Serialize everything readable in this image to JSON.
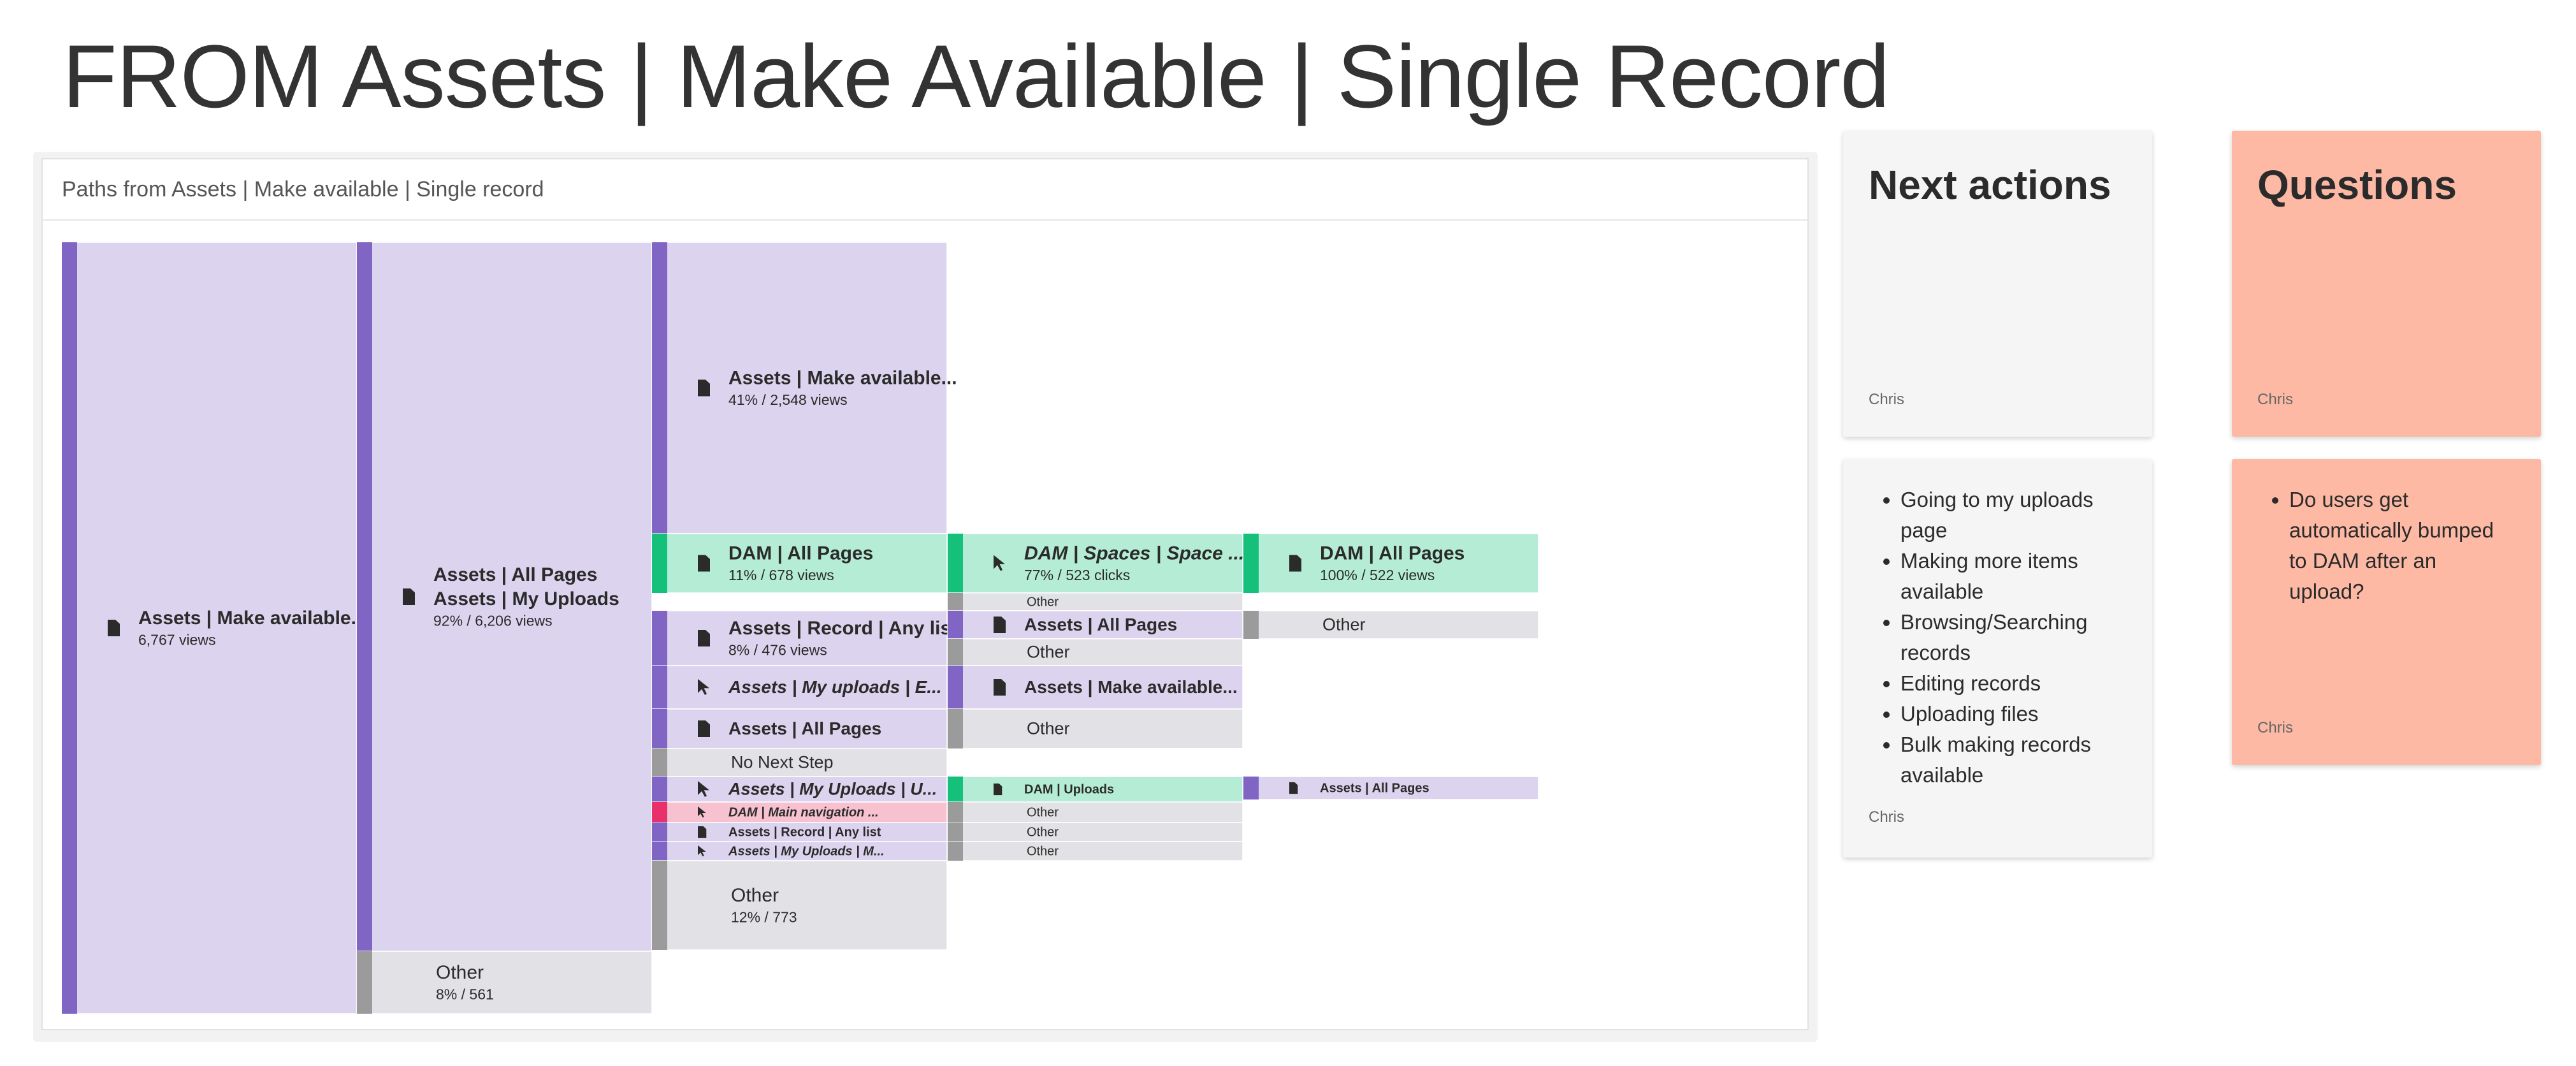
{
  "page": {
    "title": "FROM Assets | Make Available | Single Record"
  },
  "panel": {
    "title": "Paths from Assets | Make available | Single record"
  },
  "colors": {
    "purple_bar": "#8065c4",
    "purple_fill": "#dcd3ee",
    "green_bar": "#14c07a",
    "green_fill": "#b5ecd6",
    "grey_bar": "#9b9b9b",
    "grey_fill": "#e2e1e6",
    "pink_bar": "#e8316a",
    "pink_fill": "#f7c1d0",
    "card_grey": "#f5f5f5",
    "card_salmon": "#fdb9a4"
  },
  "sankey": {
    "nodes": [
      {
        "name": "Assets | Make available...",
        "sub": "6,767 views",
        "icon": "page-icon"
      },
      {
        "name": "Assets | All Pages",
        "name2": "Assets | My Uploads",
        "sub": "92% / 6,206 views",
        "icon": "page-icon"
      },
      {
        "name": "Other",
        "sub": "8% / 561"
      },
      {
        "name": "Assets | Make available...",
        "sub": "41% / 2,548 views",
        "icon": "page-icon"
      },
      {
        "name": "DAM | All Pages",
        "sub": "11% / 678 views",
        "icon": "page-icon"
      },
      {
        "name": "Assets | Record | Any list",
        "sub": "8% / 476 views",
        "icon": "page-icon"
      },
      {
        "name": "Assets | My uploads | E...",
        "icon": "click-icon"
      },
      {
        "name": "Assets | All Pages",
        "icon": "page-icon"
      },
      {
        "name": "No Next Step"
      },
      {
        "name": "Assets | My Uploads | U...",
        "icon": "click-icon"
      },
      {
        "name": "DAM | Main navigation ...",
        "icon": "click-icon"
      },
      {
        "name": "Assets | Record | Any list",
        "icon": "page-icon"
      },
      {
        "name": "Assets | My Uploads | M...",
        "icon": "click-icon"
      },
      {
        "name": "Other",
        "sub": "12% / 773"
      },
      {
        "name": "DAM | Spaces | Space ...",
        "sub": "77% / 523 clicks",
        "icon": "click-icon"
      },
      {
        "name": "Other"
      },
      {
        "name": "Assets | All Pages",
        "icon": "page-icon"
      },
      {
        "name": "Other"
      },
      {
        "name": "Assets | Make available...",
        "icon": "page-icon"
      },
      {
        "name": "Other"
      },
      {
        "name": "DAM | Uploads",
        "icon": "page-icon"
      },
      {
        "name": "Other"
      },
      {
        "name": "Other"
      },
      {
        "name": "Other"
      },
      {
        "name": "DAM | All Pages",
        "sub": "100% / 522 views",
        "icon": "page-icon"
      },
      {
        "name": "Other"
      },
      {
        "name": "Assets | All Pages",
        "icon": "page-icon"
      }
    ]
  },
  "cards": {
    "next_actions": {
      "title": "Next actions",
      "author": "Chris"
    },
    "next_actions_list": {
      "items": [
        "Going to my uploads page",
        "Making more items available",
        "Browsing/Searching records",
        "Editing records",
        "Uploading files",
        "Bulk making records available"
      ],
      "author": "Chris"
    },
    "questions": {
      "title": "Questions",
      "author": "Chris"
    },
    "questions_list": {
      "items": [
        "Do users get automatically bumped to DAM after an upload?"
      ],
      "author": "Chris"
    }
  }
}
